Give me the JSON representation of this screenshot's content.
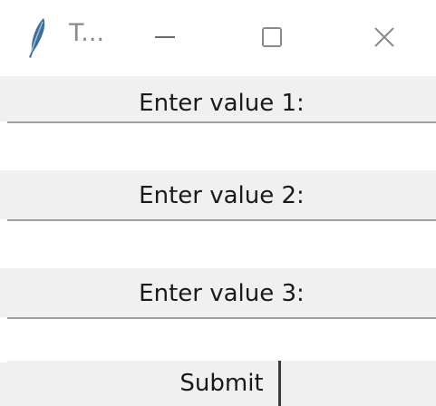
{
  "window": {
    "title": "T...",
    "icon": "feather-icon",
    "controls": {
      "minimize_icon": "minimize-icon",
      "maximize_icon": "maximize-icon",
      "close_icon": "close-icon"
    }
  },
  "form": {
    "fields": [
      {
        "label": "Enter value 1:",
        "value": ""
      },
      {
        "label": "Enter value 2:",
        "value": ""
      },
      {
        "label": "Enter value 3:",
        "value": ""
      }
    ],
    "submit_label": "Submit"
  },
  "colors": {
    "window_bg": "#f0f0f0",
    "titlebar_bg": "#ffffff",
    "icon_blue": "#3c6e9c"
  }
}
